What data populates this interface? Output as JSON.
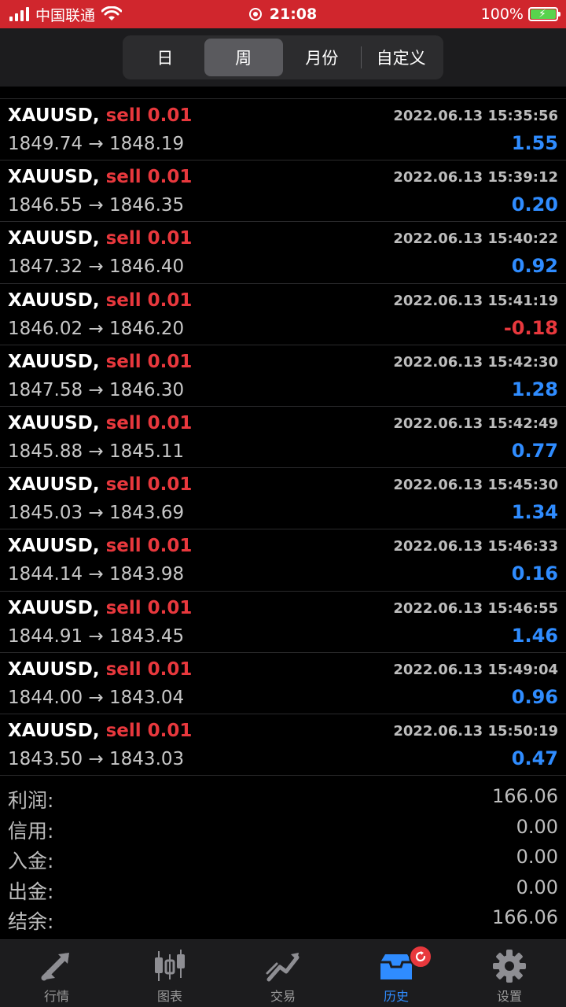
{
  "status_bar": {
    "carrier": "中国联通",
    "time": "21:08",
    "battery": "100%"
  },
  "period_tabs": [
    {
      "label": "日",
      "active": false
    },
    {
      "label": "周",
      "active": true
    },
    {
      "label": "月份",
      "active": false
    },
    {
      "label": "自定义",
      "active": false
    }
  ],
  "trades": [
    {
      "symbol": "XAUUSD,",
      "side": "sell 0.01",
      "time": "2022.06.13 15:35:56",
      "open": "1849.74",
      "close": "1848.19",
      "profit": "1.55",
      "negative": false
    },
    {
      "symbol": "XAUUSD,",
      "side": "sell 0.01",
      "time": "2022.06.13 15:39:12",
      "open": "1846.55",
      "close": "1846.35",
      "profit": "0.20",
      "negative": false
    },
    {
      "symbol": "XAUUSD,",
      "side": "sell 0.01",
      "time": "2022.06.13 15:40:22",
      "open": "1847.32",
      "close": "1846.40",
      "profit": "0.92",
      "negative": false
    },
    {
      "symbol": "XAUUSD,",
      "side": "sell 0.01",
      "time": "2022.06.13 15:41:19",
      "open": "1846.02",
      "close": "1846.20",
      "profit": "-0.18",
      "negative": true
    },
    {
      "symbol": "XAUUSD,",
      "side": "sell 0.01",
      "time": "2022.06.13 15:42:30",
      "open": "1847.58",
      "close": "1846.30",
      "profit": "1.28",
      "negative": false
    },
    {
      "symbol": "XAUUSD,",
      "side": "sell 0.01",
      "time": "2022.06.13 15:42:49",
      "open": "1845.88",
      "close": "1845.11",
      "profit": "0.77",
      "negative": false
    },
    {
      "symbol": "XAUUSD,",
      "side": "sell 0.01",
      "time": "2022.06.13 15:45:30",
      "open": "1845.03",
      "close": "1843.69",
      "profit": "1.34",
      "negative": false
    },
    {
      "symbol": "XAUUSD,",
      "side": "sell 0.01",
      "time": "2022.06.13 15:46:33",
      "open": "1844.14",
      "close": "1843.98",
      "profit": "0.16",
      "negative": false
    },
    {
      "symbol": "XAUUSD,",
      "side": "sell 0.01",
      "time": "2022.06.13 15:46:55",
      "open": "1844.91",
      "close": "1843.45",
      "profit": "1.46",
      "negative": false
    },
    {
      "symbol": "XAUUSD,",
      "side": "sell 0.01",
      "time": "2022.06.13 15:49:04",
      "open": "1844.00",
      "close": "1843.04",
      "profit": "0.96",
      "negative": false
    },
    {
      "symbol": "XAUUSD,",
      "side": "sell 0.01",
      "time": "2022.06.13 15:50:19",
      "open": "1843.50",
      "close": "1843.03",
      "profit": "0.47",
      "negative": false
    }
  ],
  "arrow": "→",
  "summary": [
    {
      "label": "利润:",
      "value": "166.06"
    },
    {
      "label": "信用:",
      "value": "0.00"
    },
    {
      "label": "入金:",
      "value": "0.00"
    },
    {
      "label": "出金:",
      "value": "0.00"
    },
    {
      "label": "结余:",
      "value": "166.06"
    }
  ],
  "tabbar": [
    {
      "label": "行情",
      "icon": "quotes-icon",
      "active": false
    },
    {
      "label": "图表",
      "icon": "chart-candles-icon",
      "active": false
    },
    {
      "label": "交易",
      "icon": "trade-icon",
      "active": false
    },
    {
      "label": "历史",
      "icon": "history-icon",
      "active": true
    },
    {
      "label": "设置",
      "icon": "gear-icon",
      "active": false
    }
  ],
  "colors": {
    "status_bar": "#d0262d",
    "profit_positive": "#2f8cff",
    "profit_negative": "#e8383d",
    "sell": "#e8383d",
    "active_tab": "#2f8cff"
  }
}
